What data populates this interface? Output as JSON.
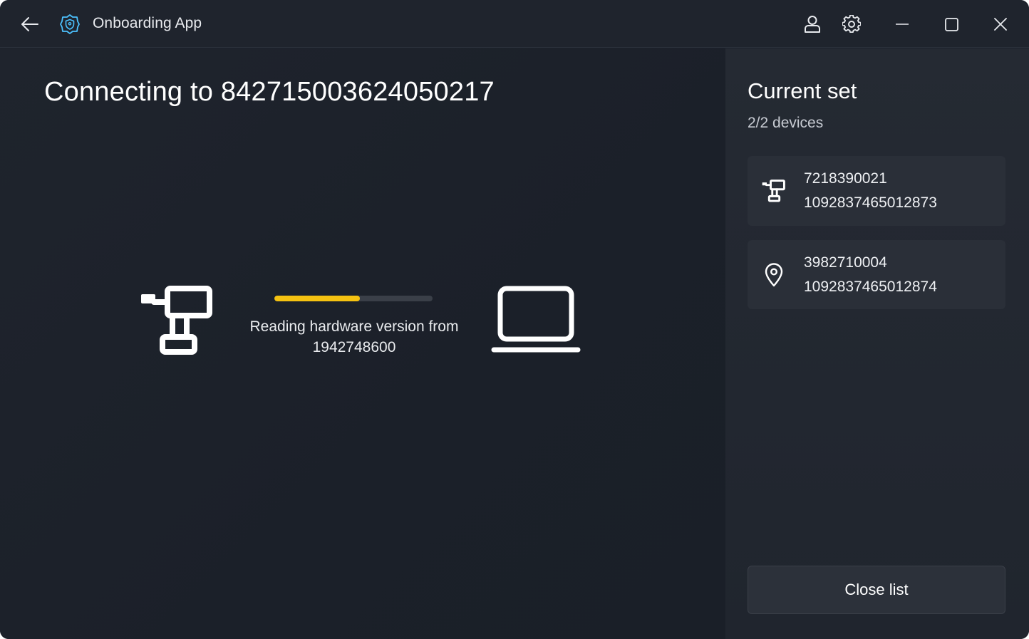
{
  "titlebar": {
    "app_title": "Onboarding App",
    "icons": {
      "back": "arrow-left-icon",
      "app": "shield-icon",
      "user": "user-icon",
      "settings": "gear-icon",
      "minimize": "minimize-icon",
      "maximize": "maximize-icon",
      "close": "close-icon"
    }
  },
  "main": {
    "title": "Connecting to 842715003624050217",
    "progress": {
      "fraction": 0.54,
      "message": "Reading hardware version from 1942748600",
      "color": "#f5c211"
    },
    "illustrations": {
      "source": "power-drill-icon",
      "target": "laptop-icon"
    }
  },
  "side_panel": {
    "title": "Current set",
    "subtitle": "2/2 devices",
    "devices": [
      {
        "icon": "power-drill-icon",
        "line1": "7218390021",
        "line2": "1092837465012873"
      },
      {
        "icon": "location-pin-icon",
        "line1": "3982710004",
        "line2": "1092837465012874"
      }
    ],
    "close_button": "Close list"
  },
  "colors": {
    "background": "#1c212b",
    "panel": "#252a33",
    "card": "#2a2f38",
    "accent": "#f5c211",
    "app_icon": "#4cc2ff"
  }
}
